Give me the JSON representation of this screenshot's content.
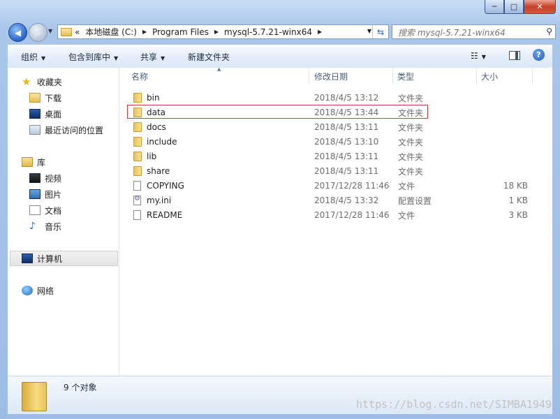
{
  "window": {
    "min_label": "─",
    "max_label": "□",
    "close_label": "✕"
  },
  "address": {
    "chevrons": "«",
    "crumbs": [
      "本地磁盘 (C:)",
      "Program Files",
      "mysql-5.7.21-winx64"
    ],
    "search_placeholder": "搜索 mysql-5.7.21-winx64"
  },
  "toolbar": {
    "organize": "组织",
    "include_library": "包含到库中",
    "share": "共享",
    "new_folder": "新建文件夹"
  },
  "nav": {
    "favorites": "收藏夹",
    "downloads": "下载",
    "desktop": "桌面",
    "recent": "最近访问的位置",
    "libraries": "库",
    "videos": "视频",
    "pictures": "图片",
    "documents": "文档",
    "music": "音乐",
    "computer": "计算机",
    "network": "网络"
  },
  "columns": {
    "name": "名称",
    "date": "修改日期",
    "type": "类型",
    "size": "大小"
  },
  "files": [
    {
      "name": "bin",
      "date": "2018/4/5 13:12",
      "type": "文件夹",
      "size": "",
      "icon": "folder"
    },
    {
      "name": "data",
      "date": "2018/4/5 13:44",
      "type": "文件夹",
      "size": "",
      "icon": "folder"
    },
    {
      "name": "docs",
      "date": "2018/4/5 13:11",
      "type": "文件夹",
      "size": "",
      "icon": "folder"
    },
    {
      "name": "include",
      "date": "2018/4/5 13:10",
      "type": "文件夹",
      "size": "",
      "icon": "folder"
    },
    {
      "name": "lib",
      "date": "2018/4/5 13:11",
      "type": "文件夹",
      "size": "",
      "icon": "folder"
    },
    {
      "name": "share",
      "date": "2018/4/5 13:11",
      "type": "文件夹",
      "size": "",
      "icon": "folder"
    },
    {
      "name": "COPYING",
      "date": "2017/12/28 11:46",
      "type": "文件",
      "size": "18 KB",
      "icon": "doc"
    },
    {
      "name": "my.ini",
      "date": "2018/4/5 13:32",
      "type": "配置设置",
      "size": "1 KB",
      "icon": "gear-doc"
    },
    {
      "name": "README",
      "date": "2017/12/28 11:46",
      "type": "文件",
      "size": "3 KB",
      "icon": "doc"
    }
  ],
  "status": {
    "item_count": "9 个对象"
  },
  "watermark": "https://blog.csdn.net/SIMBA1949",
  "colors": {
    "highlight_border": "#d9383a",
    "accent": "#2b6cc4"
  }
}
